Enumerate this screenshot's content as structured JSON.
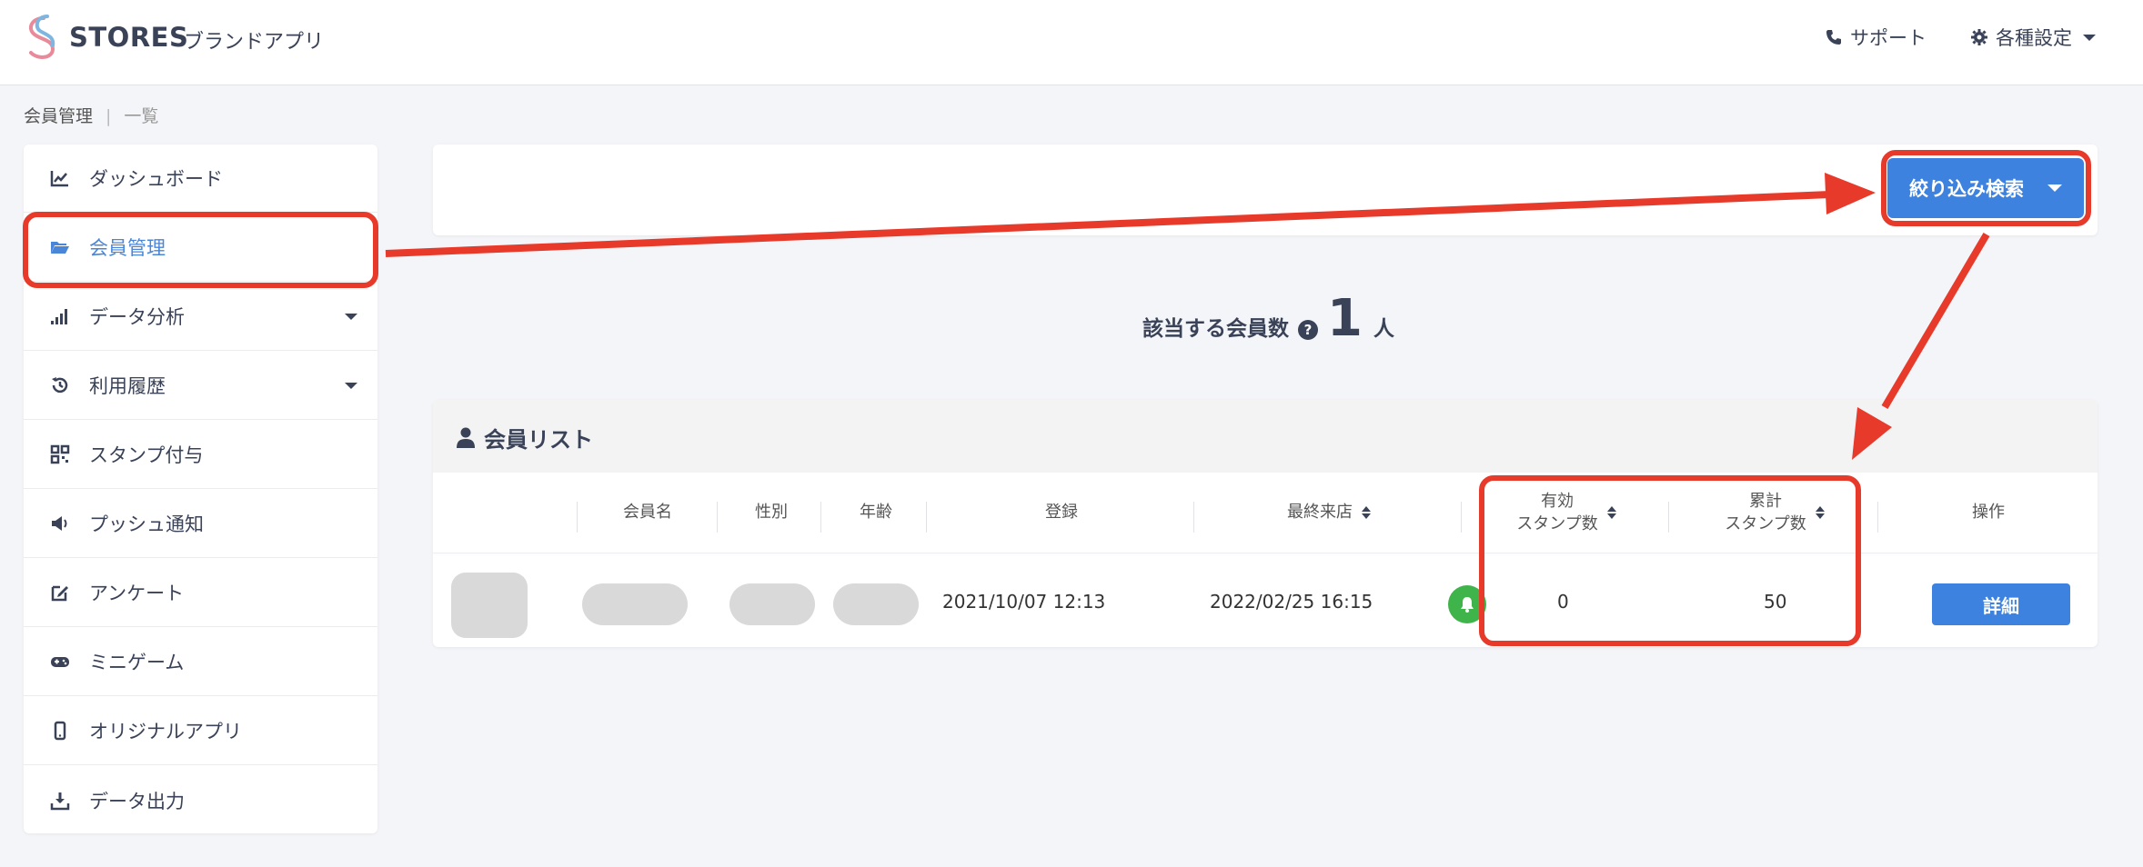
{
  "header": {
    "logo_text": "STORES",
    "logo_sub": "ブランドアプリ",
    "support_label": "サポート",
    "settings_label": "各種設定"
  },
  "breadcrumb": {
    "parent": "会員管理",
    "separator": "|",
    "current": "一覧"
  },
  "sidebar": {
    "items": [
      {
        "label": "ダッシュボード",
        "icon": "chart-line-icon"
      },
      {
        "label": "会員管理",
        "icon": "folder-open-icon",
        "active": true
      },
      {
        "label": "データ分析",
        "icon": "signal-bars-icon",
        "expandable": true
      },
      {
        "label": "利用履歴",
        "icon": "history-icon",
        "expandable": true
      },
      {
        "label": "スタンプ付与",
        "icon": "qrcode-icon"
      },
      {
        "label": "プッシュ通知",
        "icon": "megaphone-icon"
      },
      {
        "label": "アンケート",
        "icon": "edit-icon"
      },
      {
        "label": "ミニゲーム",
        "icon": "gamepad-icon"
      },
      {
        "label": "オリジナルアプリ",
        "icon": "mobile-icon"
      },
      {
        "label": "データ出力",
        "icon": "download-icon"
      }
    ]
  },
  "filter": {
    "button_label": "絞り込み検索"
  },
  "member_count": {
    "label": "該当する会員数",
    "help": "?",
    "value": "1",
    "unit": "人"
  },
  "member_list": {
    "title": "会員リスト",
    "columns": {
      "name": "会員名",
      "gender": "性別",
      "age": "年齢",
      "registered": "登録",
      "last_visit": "最終来店",
      "valid_stamps_line1": "有効",
      "valid_stamps_line2": "スタンプ数",
      "total_stamps_line1": "累計",
      "total_stamps_line2": "スタンプ数",
      "actions": "操作"
    },
    "rows": [
      {
        "registered": "2021/10/07 12:13",
        "last_visit": "2022/02/25 16:15",
        "valid_stamps": "0",
        "total_stamps": "50",
        "detail_label": "詳細"
      }
    ]
  },
  "colors": {
    "accent": "#3c82de",
    "highlight": "#e73a2a",
    "notify_green": "#3fb44a",
    "text_dark": "#3a4258"
  }
}
